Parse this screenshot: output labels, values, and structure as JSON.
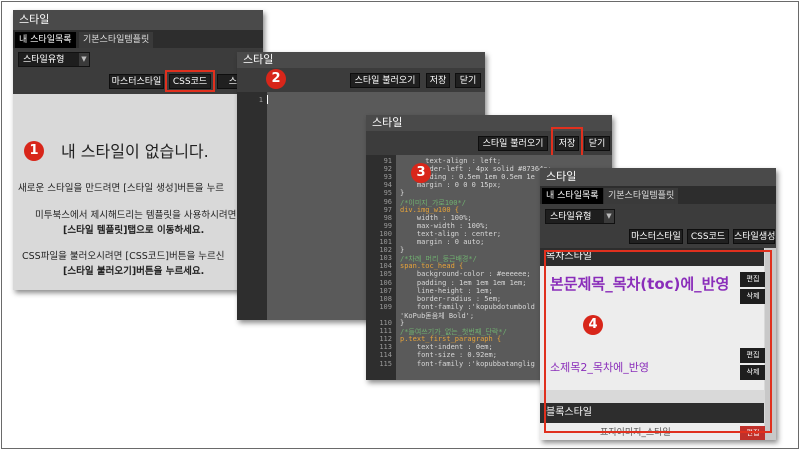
{
  "panel1": {
    "title": "스타일",
    "tab_mine": "내 스타일목록",
    "tab_basic": "기본스타일템플릿",
    "dropdown": "스타일유형",
    "btn_master": "마스터스타일",
    "btn_css": "CSS코드",
    "btn_partial": "스타",
    "badge": "1",
    "empty": "내 스타일이 없습니다.",
    "line1": "새로운 스타일을 만드려면 [스타일 생성]버튼을 누르",
    "line2": "미투북스에서 제시해드리는 템플릿을 사용하시려면",
    "line3": "[스타일 템플릿]탭으로 이동하세요.",
    "line4": "CSS파일을 불러오시려면 [CSS코드]버튼을 누르신",
    "line5": "[스타일 불러오기]버튼을 누르세요."
  },
  "panel2": {
    "title": "스타일",
    "badge": "2",
    "btn_load": "스타일 불러오기",
    "btn_save": "저장",
    "btn_close": "닫기",
    "line_no": "1"
  },
  "panel3": {
    "title": "스타일",
    "badge": "3",
    "btn_load": "스타일 불러오기",
    "btn_save": "저장",
    "btn_close": "닫기",
    "lines": [
      {
        "n": "91",
        "t": "      text-align : left;",
        "c": "c-prop"
      },
      {
        "n": "92",
        "t": "    border-left : 4px solid #87364e;",
        "c": "c-prop"
      },
      {
        "n": "93",
        "t": "    padding : 0.5em 1em 0.5em 1e",
        "c": "c-prop"
      },
      {
        "n": "94",
        "t": "    margin : 0 0 0 15px;",
        "c": "c-prop"
      },
      {
        "n": "95",
        "t": "}",
        "c": "c-plain"
      },
      {
        "n": "96",
        "t": "/*이미지_가로100*/",
        "c": "c-com"
      },
      {
        "n": "97",
        "t": "div.img_w100 {",
        "c": "c-sel"
      },
      {
        "n": "98",
        "t": "    width : 100%;",
        "c": "c-prop"
      },
      {
        "n": "99",
        "t": "    max-width : 100%;",
        "c": "c-prop"
      },
      {
        "n": "100",
        "t": "    text-align : center;",
        "c": "c-prop"
      },
      {
        "n": "101",
        "t": "    margin : 0 auto;",
        "c": "c-prop"
      },
      {
        "n": "102",
        "t": "}",
        "c": "c-plain"
      },
      {
        "n": "103",
        "t": "/*차례_머리_둥근배경*/",
        "c": "c-com"
      },
      {
        "n": "104",
        "t": "span.toc_head {",
        "c": "c-sel"
      },
      {
        "n": "105",
        "t": "    background-color : #eeeeee;",
        "c": "c-prop"
      },
      {
        "n": "106",
        "t": "    padding : 1em 1em 1em 1em;",
        "c": "c-prop"
      },
      {
        "n": "107",
        "t": "    line-height : 1em;",
        "c": "c-prop"
      },
      {
        "n": "108",
        "t": "    border-radius : 5em;",
        "c": "c-prop"
      },
      {
        "n": "109",
        "t": "    font-family :'kopubdotumbold",
        "c": "c-prop"
      },
      {
        "n": "",
        "t": "'KoPub돋움체 Bold';",
        "c": "c-prop"
      },
      {
        "n": "110",
        "t": "}",
        "c": "c-plain"
      },
      {
        "n": "111",
        "t": "/*들여쓰기가_없는_첫번째_단락*/",
        "c": "c-com"
      },
      {
        "n": "112",
        "t": "p.text_first_paragraph {",
        "c": "c-sel"
      },
      {
        "n": "113",
        "t": "    text-indent : 0em;",
        "c": "c-prop"
      },
      {
        "n": "114",
        "t": "    font-size : 0.92em;",
        "c": "c-prop"
      },
      {
        "n": "115",
        "t": "    font-family :'kopubbatanglig",
        "c": "c-prop"
      }
    ]
  },
  "panel4": {
    "title": "스타일",
    "tab_mine": "내 스타일목록",
    "tab_basic": "기본스타일템플릿",
    "dropdown": "스타일유형",
    "btn_master": "마스터스타일",
    "btn_css": "CSS코드",
    "btn_create": "스타일생성",
    "section_toc": "목차스타일",
    "style1": "본문제목_목차(toc)에_반영",
    "style2": "소제목2_목차에_반영",
    "edit": "편집",
    "delete": "삭제",
    "badge": "4",
    "section_block": "블록스타일",
    "partial": "표지이미지_스타일"
  }
}
